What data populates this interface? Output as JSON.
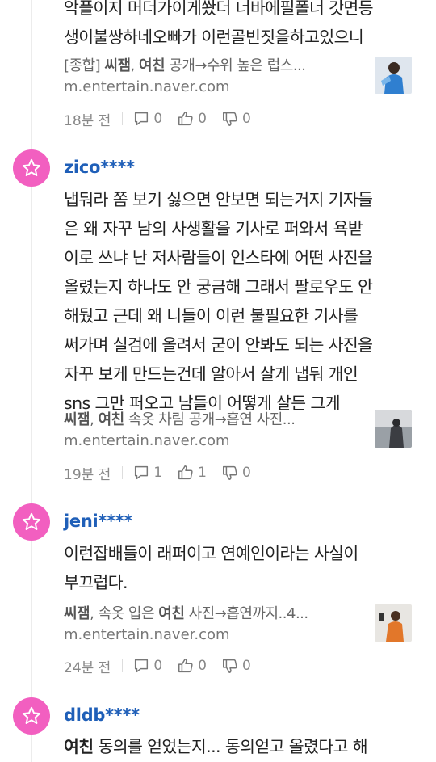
{
  "comments": [
    {
      "body_lines": [
        "악플이지 머더가이게쐈더 너바에필폴너 갓면등",
        "생이불쌍하네오빠가 이런골빈짓을하고있으니"
      ],
      "link": {
        "prefix": "[종합] ",
        "bold1": "씨잼",
        "sep": ", ",
        "bold2": "여친",
        "rest": " 공개→수위 높은 럽스...",
        "domain": "m.entertain.naver.com"
      },
      "time": "18분 전",
      "replies": "0",
      "likes": "0",
      "dislikes": "0"
    },
    {
      "username": "zico****",
      "body_lines": [
        "냅둬라 쫌 보기 싫으면 안보면 되는거지 기자들",
        "은 왜 자꾸 남의 사생활을 기사로 퍼와서 욕받",
        "이로 쓰냐 난 저사람들이 인스타에 어떤 사진을",
        "올렸는지 하나도 안 궁금해 그래서 팔로우도 안",
        "해뒀고 근데 왜 니들이 이런 불필요한 기사를",
        "써가며 실검에 올려서 굳이 안봐도 되는 사진을",
        "자꾸 보게 만드는건데 알아서 살게 냅둬 개인",
        "sns 그만 퍼오고 남들이 어떻게 살든 그게"
      ],
      "link": {
        "prefix": "",
        "bold1": "씨잼",
        "sep": ", ",
        "bold2": "여친",
        "rest": " 속옷 차림 공개→흡연 사진...",
        "domain": "m.entertain.naver.com"
      },
      "time": "19분 전",
      "replies": "1",
      "likes": "1",
      "dislikes": "0"
    },
    {
      "username": "jeni****",
      "body_lines": [
        "이런잡배들이 래퍼이고 연예인이라는 사실이",
        "부끄럽다."
      ],
      "link": {
        "prefix": "",
        "bold1": "씨잼",
        "sep": ", 속옷 입은 ",
        "bold2": "여친",
        "rest": " 사진→흡연까지..4...",
        "domain": "m.entertain.naver.com"
      },
      "time": "24분 전",
      "replies": "0",
      "likes": "0",
      "dislikes": "0"
    },
    {
      "username": "dldb****",
      "body_bold": "여친",
      "body_rest": " 동의를 얻었는지... 동의얻고 올렸다고 해"
    }
  ],
  "colors": {
    "avatar": "#f25fc0",
    "username": "#1f5fb8"
  },
  "icons": {
    "avatar": "star-icon",
    "reply": "comment-icon",
    "like": "thumbs-up-icon",
    "dislike": "thumbs-down-icon"
  }
}
